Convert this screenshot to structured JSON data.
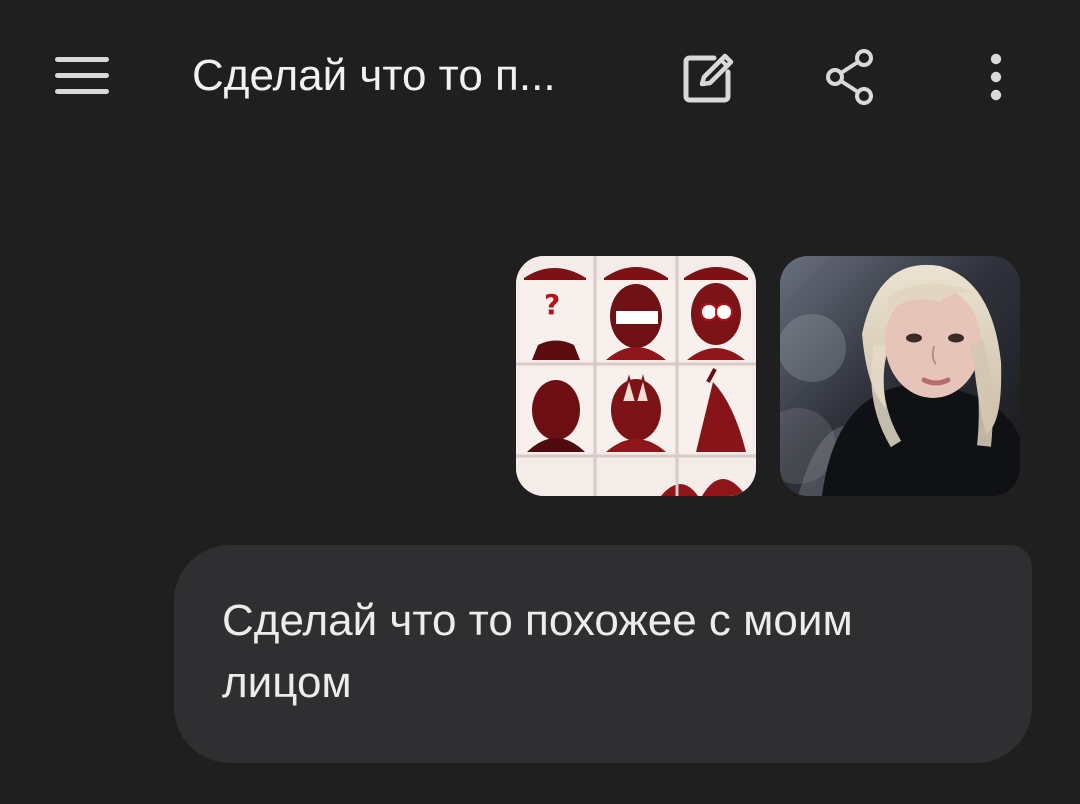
{
  "header": {
    "title": "Сделай что то п...",
    "icons": {
      "menu": "hamburger-menu-icon",
      "edit": "edit-note-icon",
      "share": "share-icon",
      "more": "more-vertical-icon"
    }
  },
  "message": {
    "text": "Сделай что то похожее с моим лицом"
  },
  "colors": {
    "background": "#1f1f1f",
    "bubble": "#2f2f31",
    "icon": "#d9d9d9",
    "text": "#ececec"
  }
}
